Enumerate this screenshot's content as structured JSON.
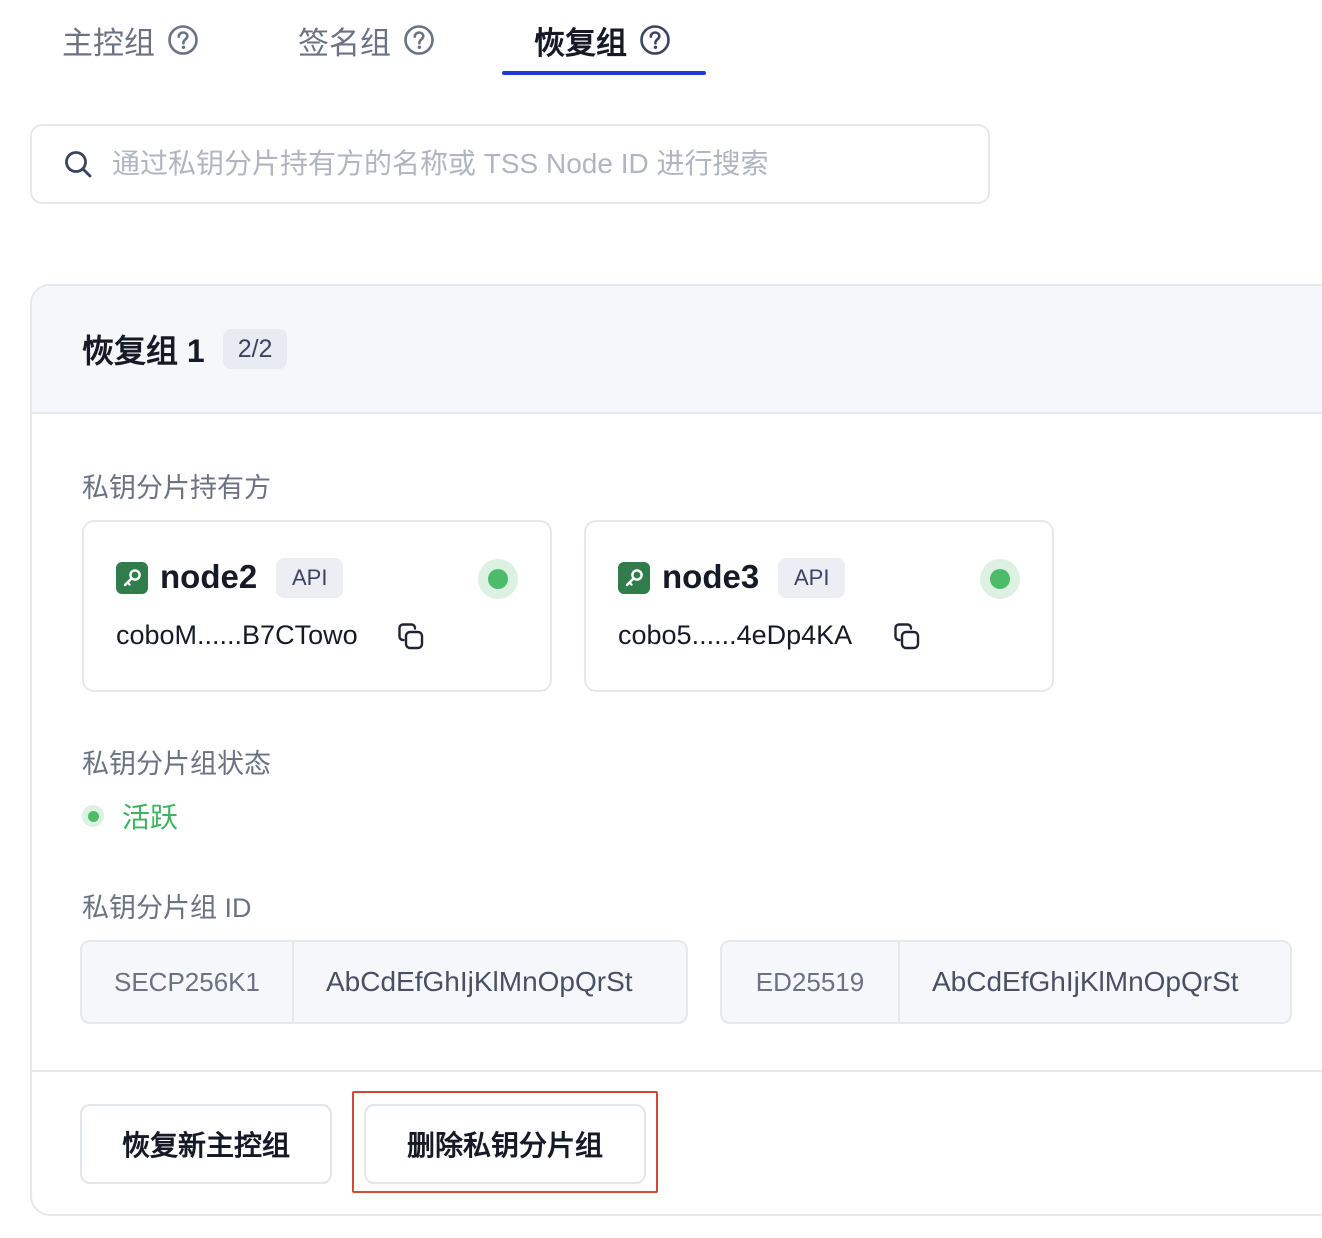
{
  "tabs": [
    {
      "label": "主控组",
      "active": false
    },
    {
      "label": "签名组",
      "active": false
    },
    {
      "label": "恢复组",
      "active": true
    }
  ],
  "search": {
    "placeholder": "通过私钥分片持有方的名称或 TSS Node ID 进行搜索",
    "value": ""
  },
  "group": {
    "title": "恢复组 1",
    "count": "2/2",
    "holders_label": "私钥分片持有方",
    "nodes": [
      {
        "name": "node2",
        "badge": "API",
        "id": "coboM......B7CTowo",
        "online": true
      },
      {
        "name": "node3",
        "badge": "API",
        "id": "cobo5......4eDp4KA",
        "online": true
      }
    ],
    "status_label": "私钥分片组状态",
    "status_value": "活跃",
    "id_label": "私钥分片组 ID",
    "ids": [
      {
        "algorithm": "SECP256K1",
        "value": "AbCdEfGhIjKlMnOpQrSt"
      },
      {
        "algorithm": "ED25519",
        "value": "AbCdEfGhIjKlMnOpQrSt"
      }
    ],
    "actions": {
      "restore_label": "恢复新主控组",
      "delete_label": "删除私钥分片组"
    }
  },
  "colors": {
    "accent": "#1e3ad6",
    "success": "#4cbc6a",
    "key_icon_bg": "#2f7d4a",
    "highlight": "#d4453a"
  },
  "icons": {
    "tab_help": "question-circle-icon",
    "search": "search-icon",
    "node": "key-icon",
    "copy": "copy-icon"
  }
}
